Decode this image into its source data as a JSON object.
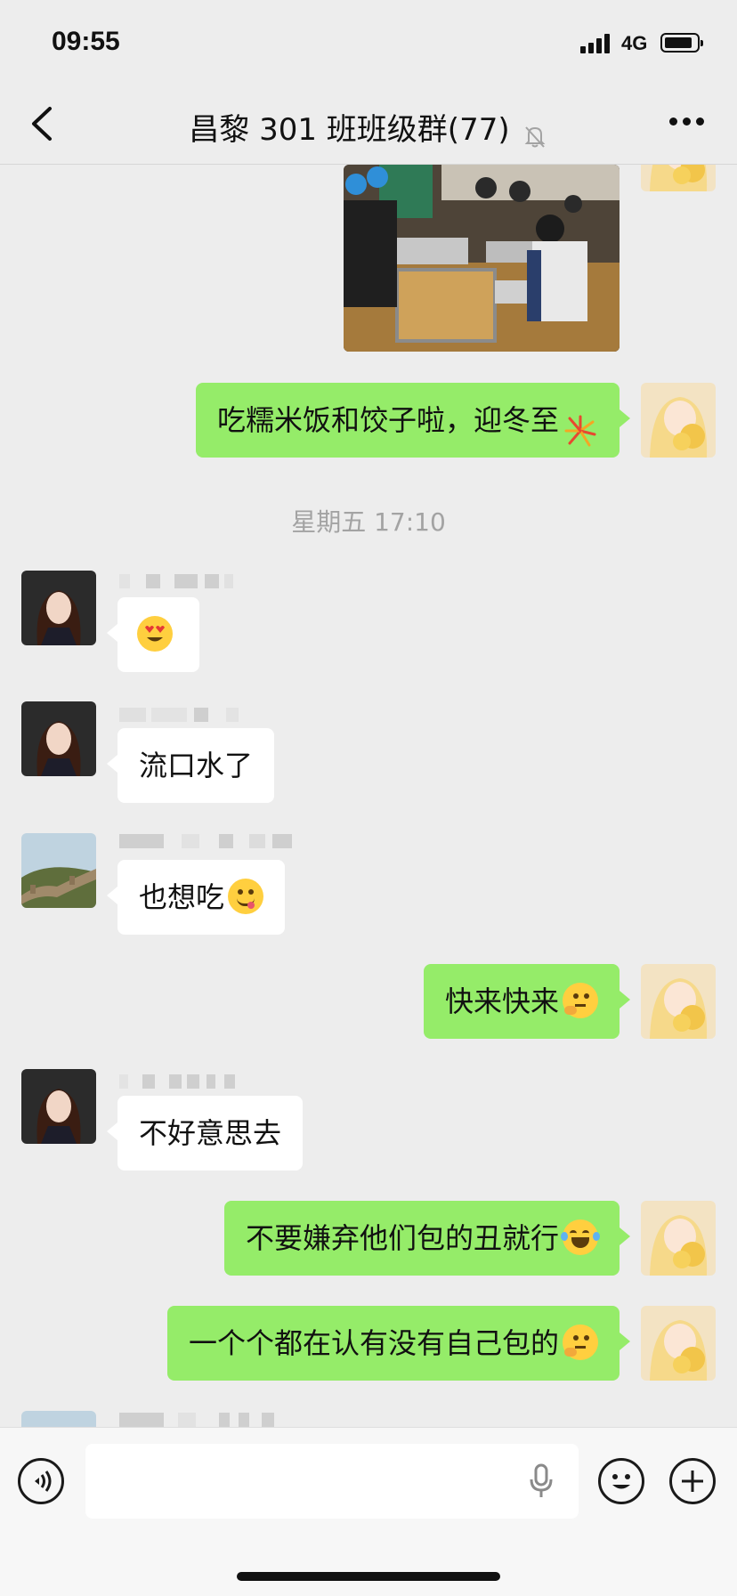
{
  "status": {
    "time": "09:55",
    "network": "4G"
  },
  "header": {
    "title": "昌黎 301 班班级群(77)",
    "back_icon": "chevron-left-icon",
    "mute_icon": "bell-slash-icon",
    "more_icon": "more-dots-icon"
  },
  "chat": {
    "timestamp": "星期五 17:10",
    "messages": [
      {
        "side": "me",
        "type": "image",
        "avatar": "flower-girl-avatar"
      },
      {
        "side": "me",
        "type": "text",
        "text": "吃糯米饭和饺子啦，迎冬至",
        "emoji": "fireworks"
      },
      {
        "side": "other",
        "type": "emoji",
        "emoji": "heart-eyes",
        "avatar": "girl-portrait-avatar"
      },
      {
        "side": "other",
        "type": "text",
        "text": "流口水了",
        "avatar": "girl-portrait-avatar"
      },
      {
        "side": "other",
        "type": "text",
        "text": "也想吃",
        "emoji": "yum",
        "avatar": "great-wall-avatar"
      },
      {
        "side": "me",
        "type": "text",
        "text": "快来快来",
        "emoji": "thinking"
      },
      {
        "side": "other",
        "type": "text",
        "text": "不好意思去",
        "avatar": "girl-portrait-avatar"
      },
      {
        "side": "me",
        "type": "text",
        "text": "不要嫌弃他们包的丑就行",
        "emoji": "laughing-tears"
      },
      {
        "side": "me",
        "type": "text",
        "text": "一个个都在认有没有自己包的",
        "emoji": "thinking"
      }
    ]
  },
  "input": {
    "voice_icon": "voice-icon",
    "mic_icon": "microphone-icon",
    "emoji_icon": "smiley-icon",
    "plus_icon": "plus-icon"
  },
  "colors": {
    "background": "#ededed",
    "my_bubble": "#95ec69",
    "other_bubble": "#ffffff",
    "timestamp": "#a3a3a3"
  }
}
